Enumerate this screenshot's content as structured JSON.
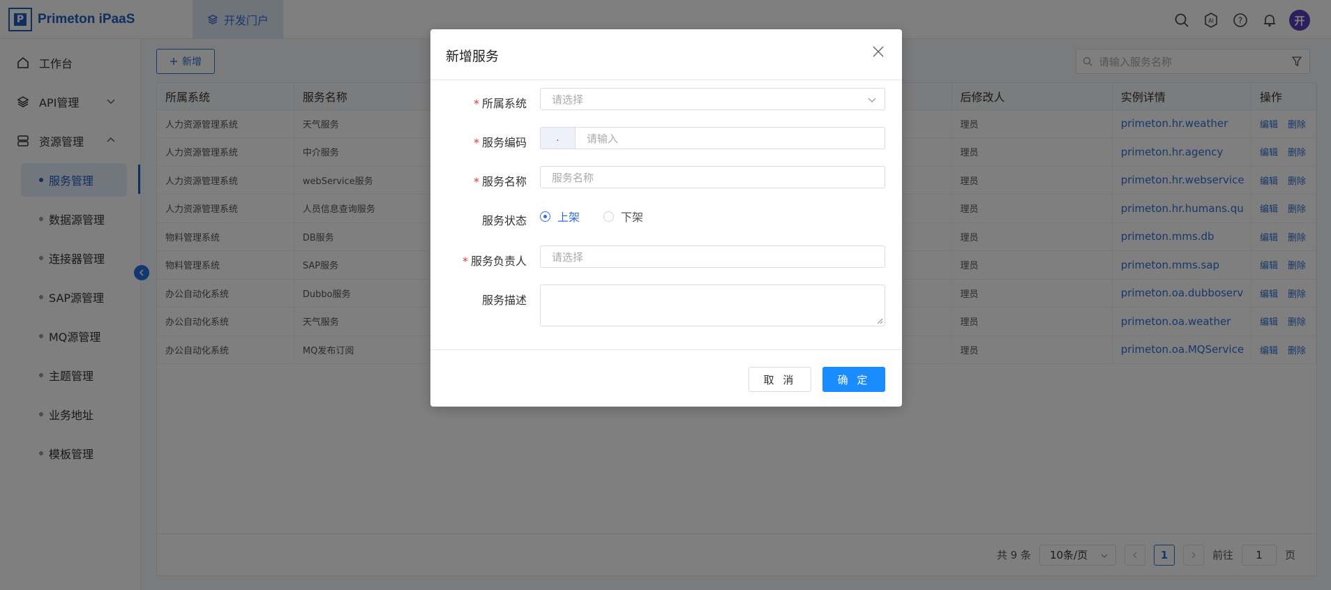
{
  "header": {
    "logo_letter": "P",
    "logo_text": "Primeton iPaaS",
    "top_tab": "开发门户",
    "avatar_text": "开",
    "ai_label": "AI"
  },
  "sidebar": {
    "items": [
      {
        "label": "工作台",
        "icon": "home-icon"
      },
      {
        "label": "API管理",
        "icon": "layers-icon"
      },
      {
        "label": "资源管理",
        "icon": "database-icon"
      }
    ],
    "sub_items": [
      {
        "label": "服务管理",
        "active": true
      },
      {
        "label": "数据源管理"
      },
      {
        "label": "连接器管理"
      },
      {
        "label": "SAP源管理"
      },
      {
        "label": "MQ源管理"
      },
      {
        "label": "主题管理"
      },
      {
        "label": "业务地址"
      },
      {
        "label": "模板管理"
      }
    ]
  },
  "toolbar": {
    "add_label": "新增",
    "search_placeholder": "请输入服务名称"
  },
  "table": {
    "headers": [
      "所属系统",
      "服务名称",
      "后修改人",
      "实例详情",
      "操作"
    ],
    "rows": [
      [
        "人力资源管理系统",
        "天气服务",
        "理员",
        "primeton.hr.weather"
      ],
      [
        "人力资源管理系统",
        "中介服务",
        "理员",
        "primeton.hr.agency"
      ],
      [
        "人力资源管理系统",
        "webService服务",
        "理员",
        "primeton.hr.webservice"
      ],
      [
        "人力资源管理系统",
        "人员信息查询服务",
        "理员",
        "primeton.hr.humans.qu"
      ],
      [
        "物料管理系统",
        "DB服务",
        "理员",
        "primeton.mms.db"
      ],
      [
        "物料管理系统",
        "SAP服务",
        "理员",
        "primeton.mms.sap"
      ],
      [
        "办公自动化系统",
        "Dubbo服务",
        "理员",
        "primeton.oa.dubboserv"
      ],
      [
        "办公自动化系统",
        "天气服务",
        "理员",
        "primeton.oa.weather"
      ],
      [
        "办公自动化系统",
        "MQ发布订阅",
        "理员",
        "primeton.oa.MQService"
      ]
    ],
    "edit_label": "编辑",
    "delete_label": "删除"
  },
  "pager": {
    "total": "共 9 条",
    "page_size": "10条/页",
    "current_page": "1",
    "goto_prefix": "前往",
    "goto_value": "1",
    "goto_suffix": "页"
  },
  "modal": {
    "title": "新增服务",
    "fields": {
      "system_label": "所属系统",
      "system_placeholder": "请选择",
      "code_label": "服务编码",
      "code_prefix": ".",
      "code_placeholder": "请输入",
      "name_label": "服务名称",
      "name_placeholder": "服务名称",
      "status_label": "服务状态",
      "status_on": "上架",
      "status_off": "下架",
      "owner_label": "服务负责人",
      "owner_placeholder": "请选择",
      "desc_label": "服务描述"
    },
    "cancel_label": "取 消",
    "ok_label": "确 定"
  }
}
